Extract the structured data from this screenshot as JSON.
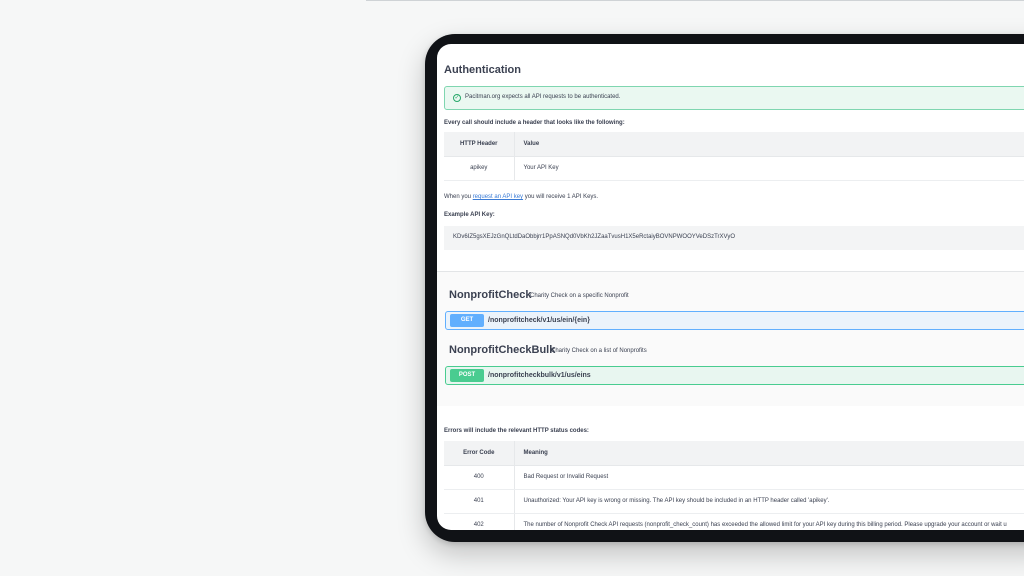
{
  "auth": {
    "title": "Authentication",
    "notice": "Pacitman.org expects all API requests to be authenticated.",
    "header_instruction": "Every call should include a header that looks like the following:",
    "header_table": {
      "columns": [
        "HTTP Header",
        "Value"
      ],
      "rows": [
        [
          "apikey",
          "Your API Key"
        ]
      ]
    },
    "receive_prefix": "When you",
    "receive_link": "request an API key",
    "receive_suffix": "you will receive 1 API Keys.",
    "example_label": "Example API Key:",
    "example_key": "KDv6IZ5gsXEJzGnQLtdDaObbjrr1PpASNQd0VbKh2JZaaTvusH1X5eRctaiyBOVNPWOOYVeDSzTrXVyO"
  },
  "endpoints": [
    {
      "title": "NonprofitCheck",
      "description": "Charity Check on a specific Nonprofit",
      "method": "GET",
      "path": "/nonprofitcheck/v1/us/ein/{ein}"
    },
    {
      "title": "NonprofitCheckBulk",
      "description": "Charity Check on a list of Nonprofits",
      "method": "POST",
      "path": "/nonprofitcheckbulk/v1/us/eins"
    }
  ],
  "errors": {
    "intro": "Errors will include the relevant HTTP status codes:",
    "columns": [
      "Error Code",
      "Meaning"
    ],
    "rows": [
      [
        "400",
        "Bad Request or Invalid Request"
      ],
      [
        "401",
        "Unauthorized: Your API key is wrong or missing. The API key should be included in an HTTP header called 'apikey'."
      ],
      [
        "402",
        "The number of Nonprofit Check API requests (nonprofit_check_count) has exceeded the allowed limit for your API key during this billing period. Please upgrade your account or wait u"
      ]
    ]
  },
  "colors": {
    "get": "#61affe",
    "post": "#49cc90",
    "success": "#27a86a",
    "link": "#3a7bd5"
  },
  "icons": {
    "notice": "check-circle-icon"
  }
}
